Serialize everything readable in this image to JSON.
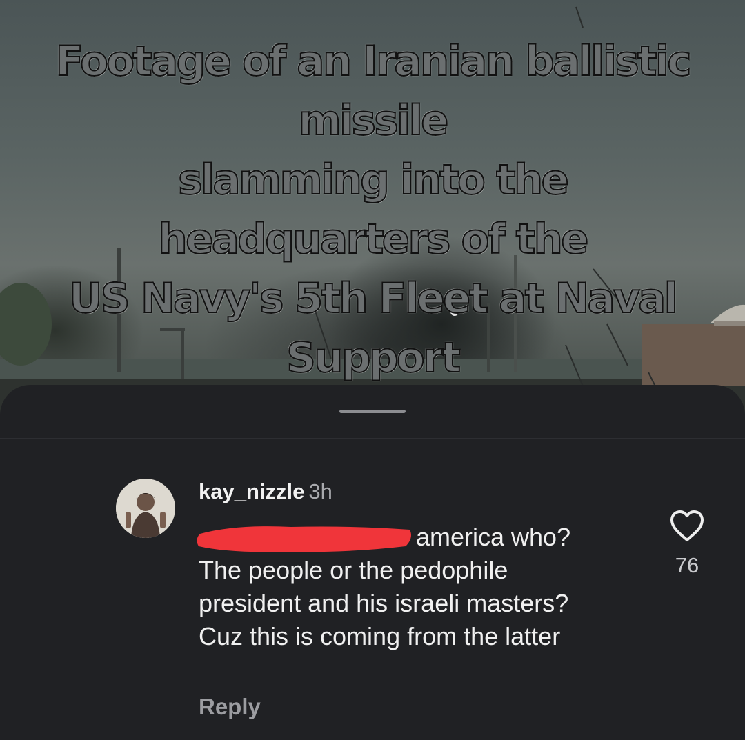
{
  "video": {
    "caption": "Footage of an Iranian ballistic missile\nslamming into the headquarters of the\nUS Navy's 5th Fleet at Naval Support\nActivity (NSA) Bahrain earlier today."
  },
  "comment": {
    "username": "kay_nizzle",
    "time": "3h",
    "text_line1": "america who?",
    "text_rest": "The people or the pedophile president and his israeli masters? Cuz this is coming from the latter",
    "reply_label": "Reply",
    "like_count": "76",
    "redaction_color": "#f0353a"
  },
  "icons": {
    "like": "heart-outline-icon",
    "handle": "drag-handle"
  }
}
